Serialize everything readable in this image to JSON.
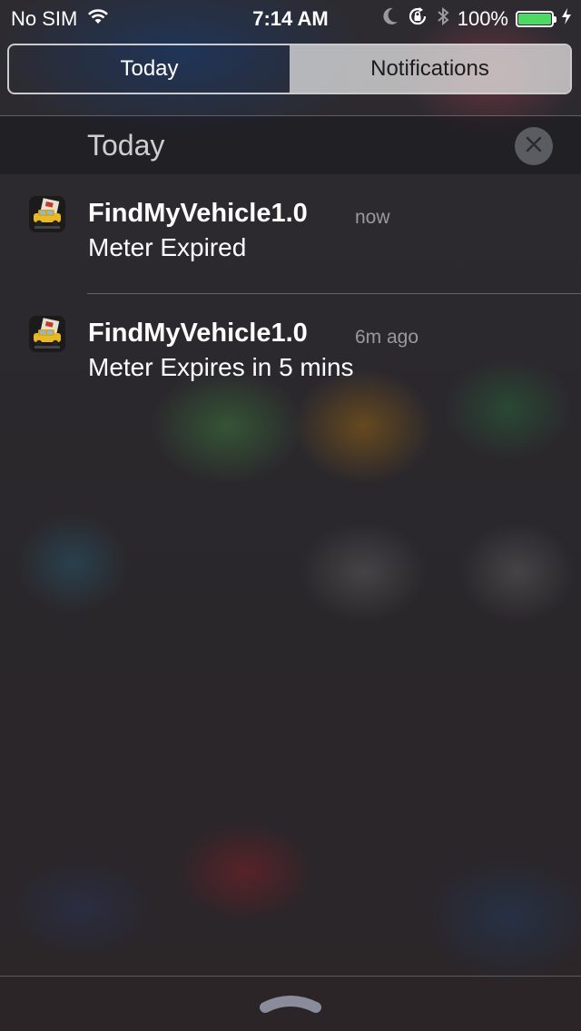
{
  "status_bar": {
    "carrier": "No SIM",
    "time": "7:14 AM",
    "battery_percent": "100%",
    "battery_level": 1.0,
    "icons": [
      "wifi-icon",
      "moon-icon",
      "rotation-lock-icon",
      "bluetooth-icon",
      "battery-icon",
      "charging-bolt-icon"
    ]
  },
  "tabs": {
    "today": "Today",
    "notifications": "Notifications",
    "selected": "notifications"
  },
  "section": {
    "title": "Today",
    "clear_icon": "close-icon"
  },
  "notifications": [
    {
      "app": "FindMyVehicle1.0",
      "time": "now",
      "message": "Meter Expired",
      "icon": "app-icon-car"
    },
    {
      "app": "FindMyVehicle1.0",
      "time": "6m ago",
      "message": "Meter Expires in 5 mins",
      "icon": "app-icon-car"
    }
  ],
  "colors": {
    "battery_green": "#4cd964",
    "selected_tab_bg": "#e6e6e6"
  }
}
